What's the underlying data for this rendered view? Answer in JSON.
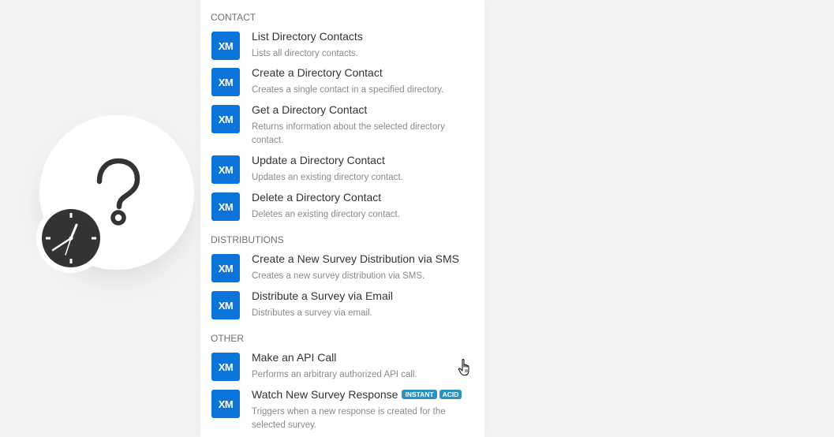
{
  "module": {
    "icon": "question-mark-icon",
    "trigger_icon": "clock-icon"
  },
  "panel": {
    "sections": [
      {
        "label": "CONTACT",
        "items": [
          {
            "tile": "XM",
            "title": "List Directory Contacts",
            "desc": "Lists all directory contacts."
          },
          {
            "tile": "XM",
            "title": "Create a Directory Contact",
            "desc": "Creates a single contact in a specified directory."
          },
          {
            "tile": "XM",
            "title": "Get a Directory Contact",
            "desc": "Returns information about the selected directory contact."
          },
          {
            "tile": "XM",
            "title": "Update a Directory Contact",
            "desc": "Updates an existing directory contact."
          },
          {
            "tile": "XM",
            "title": "Delete a Directory Contact",
            "desc": "Deletes an existing directory contact."
          }
        ]
      },
      {
        "label": "DISTRIBUTIONS",
        "items": [
          {
            "tile": "XM",
            "title": "Create a New Survey Distribution via SMS",
            "desc": "Creates a new survey distribution via SMS."
          },
          {
            "tile": "XM",
            "title": "Distribute a Survey via Email",
            "desc": "Distributes a survey via email."
          }
        ]
      },
      {
        "label": "OTHER",
        "items": [
          {
            "tile": "XM",
            "title": "Make an API Call",
            "desc": "Performs an arbitrary authorized API call."
          },
          {
            "tile": "XM",
            "title": "Watch New Survey Response",
            "desc": "Triggers when a new response is created for the selected survey.",
            "badges": [
              "INSTANT",
              "ACID"
            ]
          }
        ]
      }
    ]
  },
  "colors": {
    "tile": "#0b74d8",
    "badge": "#2a93c4",
    "background": "#f3f3f3"
  },
  "cursor": "hand-pointer-icon"
}
